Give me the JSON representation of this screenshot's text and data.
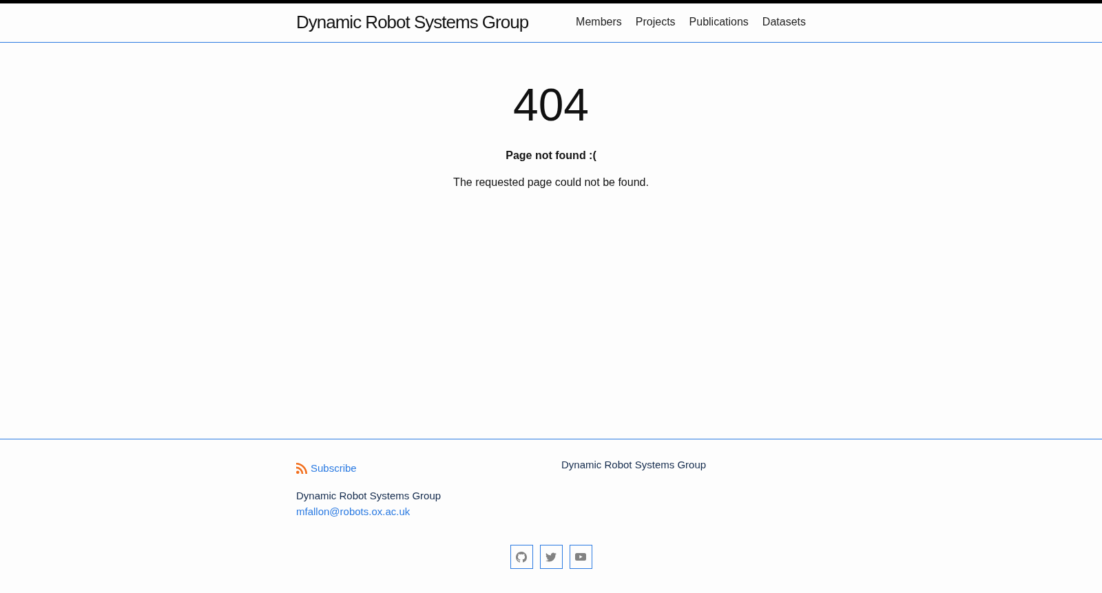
{
  "header": {
    "site_title": "Dynamic Robot Systems Group",
    "nav": [
      "Members",
      "Projects",
      "Publications",
      "Datasets"
    ]
  },
  "main": {
    "code": "404",
    "heading": "Page not found :(",
    "message": "The requested page could not be found."
  },
  "footer": {
    "subscribe": "Subscribe",
    "contact": {
      "name": "Dynamic Robot Systems Group",
      "email": "mfallon@robots.ox.ac.uk"
    },
    "description": "Dynamic Robot Systems Group",
    "social": [
      {
        "kind": "github"
      },
      {
        "kind": "twitter"
      },
      {
        "kind": "youtube"
      }
    ]
  }
}
